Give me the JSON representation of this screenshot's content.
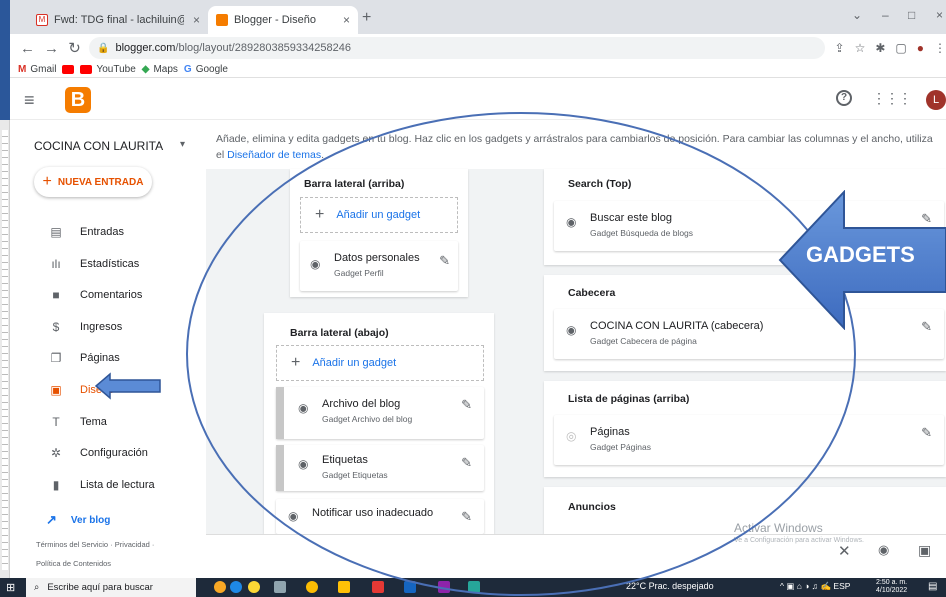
{
  "browser": {
    "tabs": [
      {
        "label": "Fwd: TDG final - lachiluin@gmail",
        "icon": "gmail-icon"
      },
      {
        "label": "Blogger - Diseño",
        "icon": "blogger-icon"
      }
    ],
    "url_host": "blogger.com",
    "url_path": "/blog/layout/2892803859334258246",
    "bookmarks": [
      "Gmail",
      "YouTube",
      "Maps",
      "Google"
    ]
  },
  "sidebar": {
    "blog_title": "COCINA CON LAURITA",
    "new_post": "NUEVA ENTRADA",
    "items": [
      {
        "label": "Entradas",
        "icon": "posts-icon"
      },
      {
        "label": "Estadísticas",
        "icon": "stats-icon"
      },
      {
        "label": "Comentarios",
        "icon": "comments-icon"
      },
      {
        "label": "Ingresos",
        "icon": "dollar-icon"
      },
      {
        "label": "Páginas",
        "icon": "pages-icon"
      },
      {
        "label": "Diseño",
        "icon": "layout-icon"
      },
      {
        "label": "Tema",
        "icon": "theme-icon"
      },
      {
        "label": "Configuración",
        "icon": "gear-icon"
      },
      {
        "label": "Lista de lectura",
        "icon": "bookmark-icon"
      }
    ],
    "view_blog": "Ver blog",
    "terms": "Términos del Servicio · Privacidad ·",
    "content_policy": "Política de Contenidos"
  },
  "main": {
    "intro": "Añade, elimina y edita gadgets en tu blog. Haz clic en los gadgets y arrástralos para cambiarlos de posición. Para cambiar las columnas y el ancho, utiliza el",
    "intro_link": "Diseñador de temas",
    "add_gadget": "Añadir un gadget",
    "sidebar_top": {
      "title": "Barra lateral (arriba)",
      "gadgets": [
        {
          "name": "Datos personales",
          "type": "Gadget Perfil"
        }
      ]
    },
    "sidebar_bottom": {
      "title": "Barra lateral (abajo)",
      "gadgets": [
        {
          "name": "Archivo del blog",
          "type": "Gadget Archivo del blog"
        },
        {
          "name": "Etiquetas",
          "type": "Gadget Etiquetas"
        },
        {
          "name": "Notificar uso inadecuado",
          "type": ""
        }
      ]
    },
    "search_top": {
      "title": "Search (Top)",
      "gadget": {
        "name": "Buscar este blog",
        "type": "Gadget Búsqueda de blogs"
      }
    },
    "header": {
      "title": "Cabecera",
      "gadget": {
        "name": "COCINA CON LAURITA (cabecera)",
        "type": "Gadget Cabecera de página"
      }
    },
    "pages_list": {
      "title": "Lista de páginas (arriba)",
      "gadget": {
        "name": "Páginas",
        "type": "Gadget Páginas"
      }
    },
    "ads": {
      "title": "Anuncios"
    }
  },
  "watermark": {
    "title": "Activar Windows",
    "subtitle": "Ve a Configuración para activar Windows."
  },
  "annotation": {
    "label": "GADGETS"
  },
  "taskbar": {
    "search": "Escribe aquí para buscar",
    "weather": "22°C  Prac. despejado",
    "lang": "ESP",
    "time": "2:50 a. m.",
    "date": "4/10/2022"
  },
  "colors": {
    "accent": "#e65100",
    "link": "#1a73e8",
    "annotation": "#4a7ccf"
  }
}
